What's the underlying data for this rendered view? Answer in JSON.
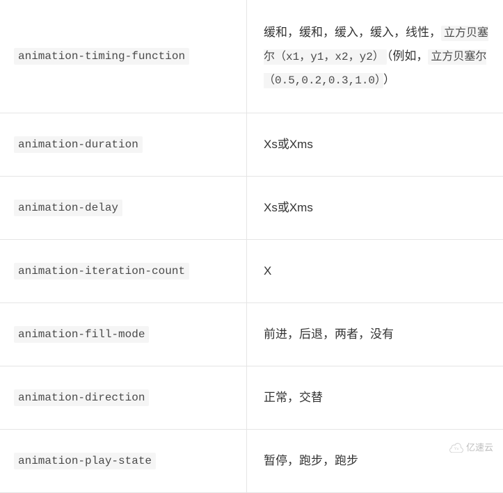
{
  "rows": [
    {
      "property": "animation-timing-function",
      "value_segments": [
        {
          "type": "text",
          "content": "缓和，缓和，缓入，缓入，线性，"
        },
        {
          "type": "code",
          "content": "立方贝塞尔（x1，y1，x2，y2）"
        },
        {
          "type": "text",
          "content": "（例如，"
        },
        {
          "type": "code",
          "content": "立方贝塞尔（0.5,0.2,0.3,1.0）"
        },
        {
          "type": "text",
          "content": "）"
        }
      ]
    },
    {
      "property": "animation-duration",
      "value_segments": [
        {
          "type": "text",
          "content": "Xs或Xms"
        }
      ]
    },
    {
      "property": "animation-delay",
      "value_segments": [
        {
          "type": "text",
          "content": "Xs或Xms"
        }
      ]
    },
    {
      "property": "animation-iteration-count",
      "value_segments": [
        {
          "type": "text",
          "content": "X"
        }
      ]
    },
    {
      "property": "animation-fill-mode",
      "value_segments": [
        {
          "type": "text",
          "content": "前进，后退，两者，没有"
        }
      ]
    },
    {
      "property": "animation-direction",
      "value_segments": [
        {
          "type": "text",
          "content": "正常，交替"
        }
      ]
    },
    {
      "property": "animation-play-state",
      "value_segments": [
        {
          "type": "text",
          "content": "暂停，跑步，跑步"
        }
      ]
    }
  ],
  "watermark": "亿速云"
}
